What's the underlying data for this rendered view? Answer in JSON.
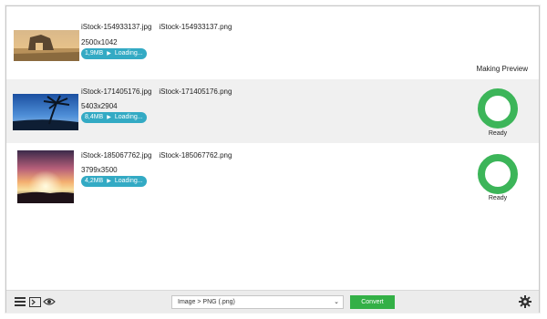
{
  "files": [
    {
      "source_name": "iStock-154933137.jpg",
      "target_name": "iStock-154933137.png",
      "dimensions": "2500x1042",
      "size": "1,9MB",
      "progress_label": "Loading...",
      "status": "Making Preview",
      "thumbnail": "beach-rock-arch"
    },
    {
      "source_name": "iStock-171405176.jpg",
      "target_name": "iStock-171405176.png",
      "dimensions": "5403x2904",
      "size": "8,4MB",
      "progress_label": "Loading...",
      "status": "Ready",
      "thumbnail": "palm-tree-silhouette"
    },
    {
      "source_name": "iStock-185067762.jpg",
      "target_name": "iStock-185067762.png",
      "dimensions": "3799x3500",
      "size": "4,2MB",
      "progress_label": "Loading...",
      "status": "Ready",
      "thumbnail": "sunset-sky"
    }
  ],
  "toolbar": {
    "format_select": "Image > PNG (.png)",
    "convert_label": "Convert",
    "icons": [
      "menu-icon",
      "terminal-icon",
      "eye-icon",
      "gear-icon"
    ]
  },
  "colors": {
    "pill": "#33aac4",
    "ready_ring": "#3cb559",
    "convert": "#33b046"
  }
}
